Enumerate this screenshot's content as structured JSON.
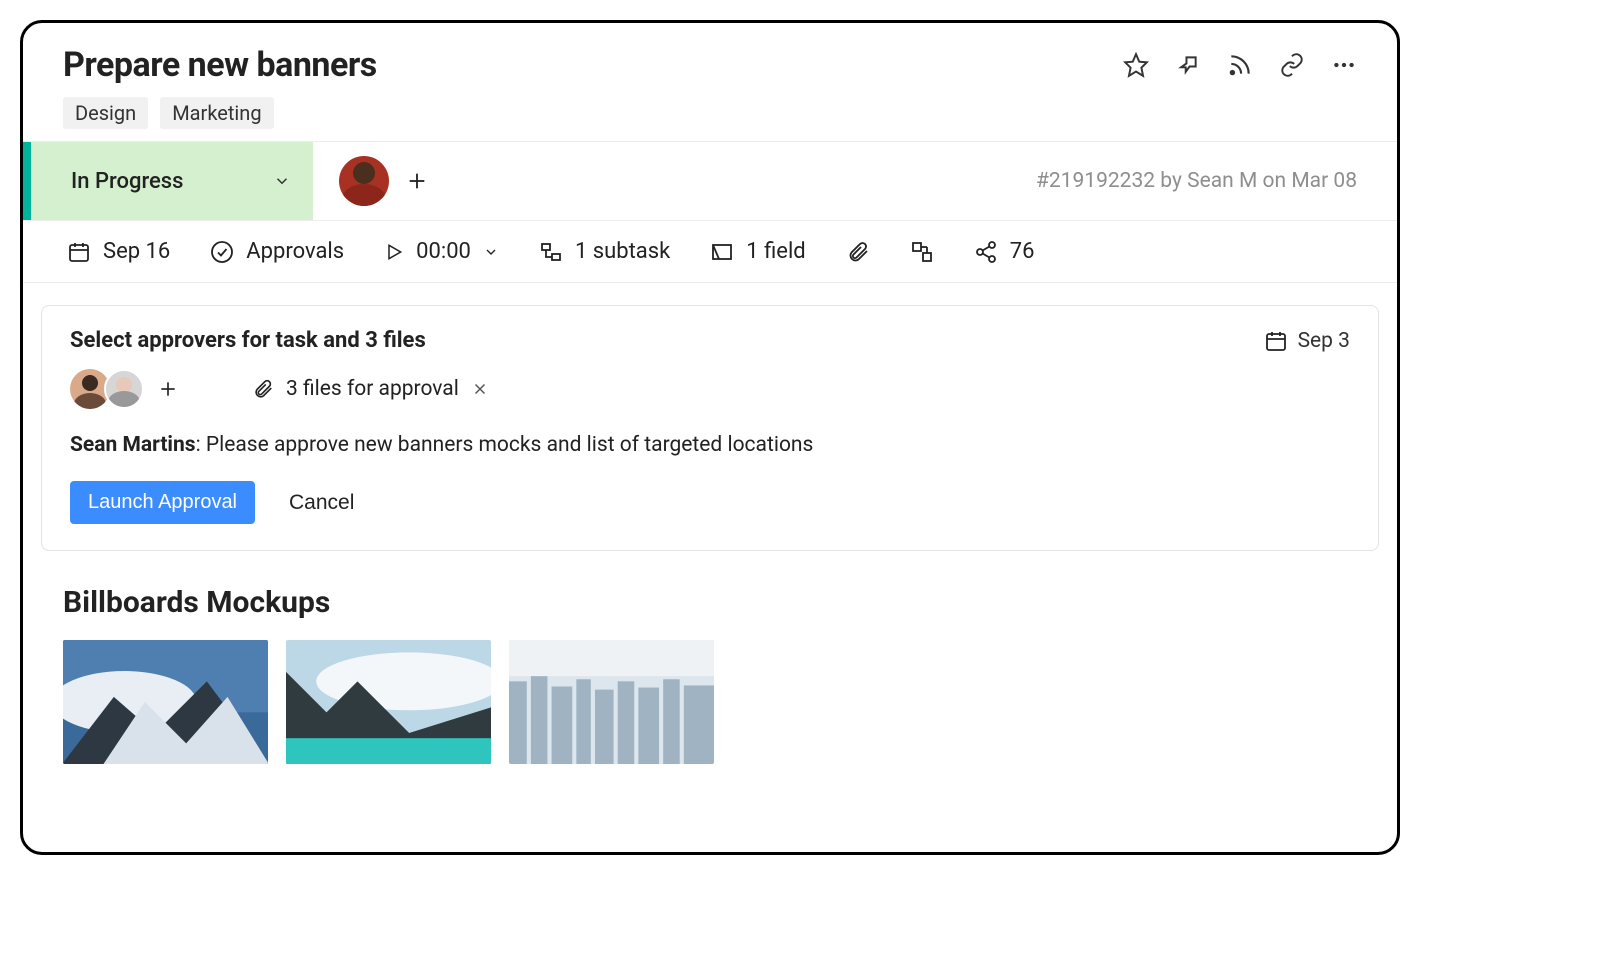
{
  "header": {
    "title": "Prepare new banners",
    "tags": [
      "Design",
      "Marketing"
    ]
  },
  "status": {
    "label": "In Progress",
    "meta_id": "#219192232",
    "meta_by_prefix": " by ",
    "meta_author": "Sean M",
    "meta_on_prefix": " on ",
    "meta_date": "Mar 08"
  },
  "toolbar": {
    "due_date": "Sep 16",
    "approvals": "Approvals",
    "timer": "00:00",
    "subtasks": "1 subtask",
    "fields": "1 field",
    "share_count": "76"
  },
  "approval_card": {
    "title": "Select approvers for task and 3 files",
    "date": "Sep 3",
    "files_label": "3 files for approval",
    "comment_author": "Sean Martins",
    "comment_sep": ": ",
    "comment_text": "Please approve new banners mocks and list of targeted locations",
    "launch_btn": "Launch Approval",
    "cancel_btn": "Cancel"
  },
  "mockups": {
    "heading": "Billboards Mockups"
  }
}
